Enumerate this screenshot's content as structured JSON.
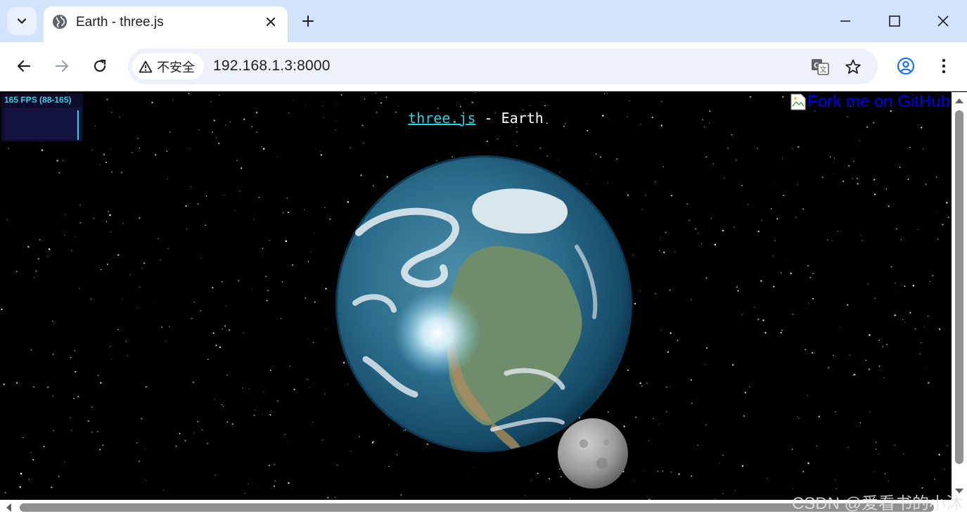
{
  "browser": {
    "tab_title": "Earth - three.js",
    "security_label": "不安全",
    "url": "192.168.1.3:8000",
    "icons": [
      "tab-search-icon",
      "globe-icon",
      "close-icon",
      "plus-icon",
      "minimize-icon",
      "maximize-icon",
      "window-close-icon",
      "back-icon",
      "forward-icon",
      "reload-icon",
      "warning-icon",
      "translate-icon",
      "star-icon",
      "profile-icon",
      "menu-icon"
    ]
  },
  "page": {
    "stats": "165 FPS (88-165)",
    "info_link": "three.js",
    "info_text": " - Earth",
    "fork_alt": "Fork me on GitHub"
  },
  "watermark": "CSDN @爱看书的小沐",
  "colors": {
    "tabstrip": "#d3e3fd",
    "omnibox": "#edf2fa",
    "stats_text": "#2ed2e0",
    "link": "#2ad0dc",
    "fork_link": "#0000ee"
  }
}
